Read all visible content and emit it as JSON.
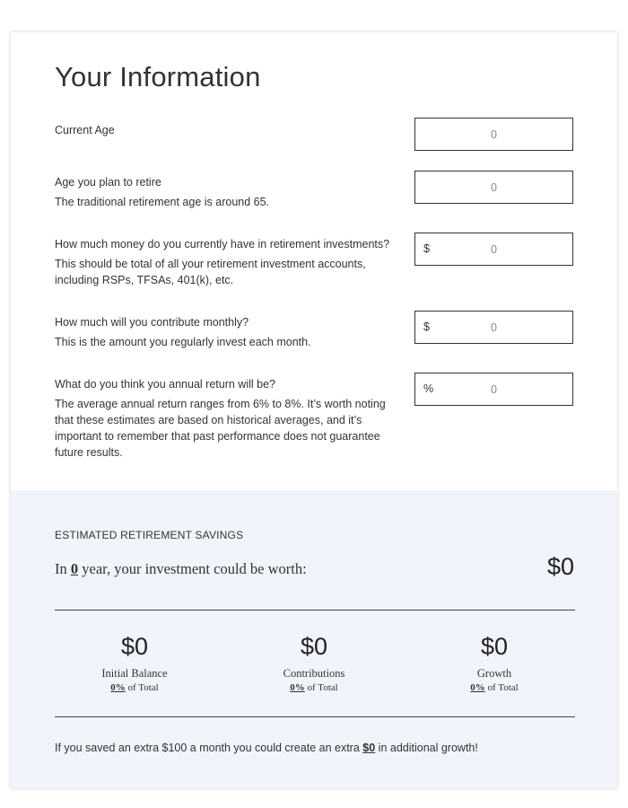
{
  "form": {
    "title": "Your Information",
    "questions": [
      {
        "label": "Current Age",
        "description": "",
        "prefix": "",
        "value": "0"
      },
      {
        "label": "Age you plan to retire",
        "description": "The traditional retirement age is around 65.",
        "prefix": "",
        "value": "0"
      },
      {
        "label": "How much money do you currently have in retirement investments?",
        "description": "This should be total of all your retirement investment accounts, including RSPs, TFSAs, 401(k), etc.",
        "prefix": "$",
        "value": "0"
      },
      {
        "label": "How much will you contribute monthly?",
        "description": "This is the amount you regularly invest each month.",
        "prefix": "$",
        "value": "0"
      },
      {
        "label": "What do you think you annual return will be?",
        "description": "The average annual return ranges from 6% to 8%. It’s worth noting that these estimates are based on historical averages, and it’s important to remember that past performance does not guarantee future results.",
        "prefix": "%",
        "value": "0"
      }
    ]
  },
  "results": {
    "heading": "ESTIMATED RETIREMENT SAVINGS",
    "sentence_prefix": "In ",
    "years": "0",
    "sentence_suffix": " year, your investment could be worth:",
    "total": "$0",
    "breakdown": [
      {
        "amount": "$0",
        "name": "Initial Balance",
        "percent": "0%",
        "percent_suffix": " of Total"
      },
      {
        "amount": "$0",
        "name": "Contributions",
        "percent": "0%",
        "percent_suffix": " of Total"
      },
      {
        "amount": "$0",
        "name": "Growth",
        "percent": "0%",
        "percent_suffix": " of Total"
      }
    ],
    "note_prefix": "If you saved an extra $100 a month you could create an extra ",
    "note_amount": "$0",
    "note_suffix": " in additional growth!"
  },
  "colors": {
    "results_background": "#f1f4fb",
    "field_border": "#333333",
    "text": "#333333"
  }
}
